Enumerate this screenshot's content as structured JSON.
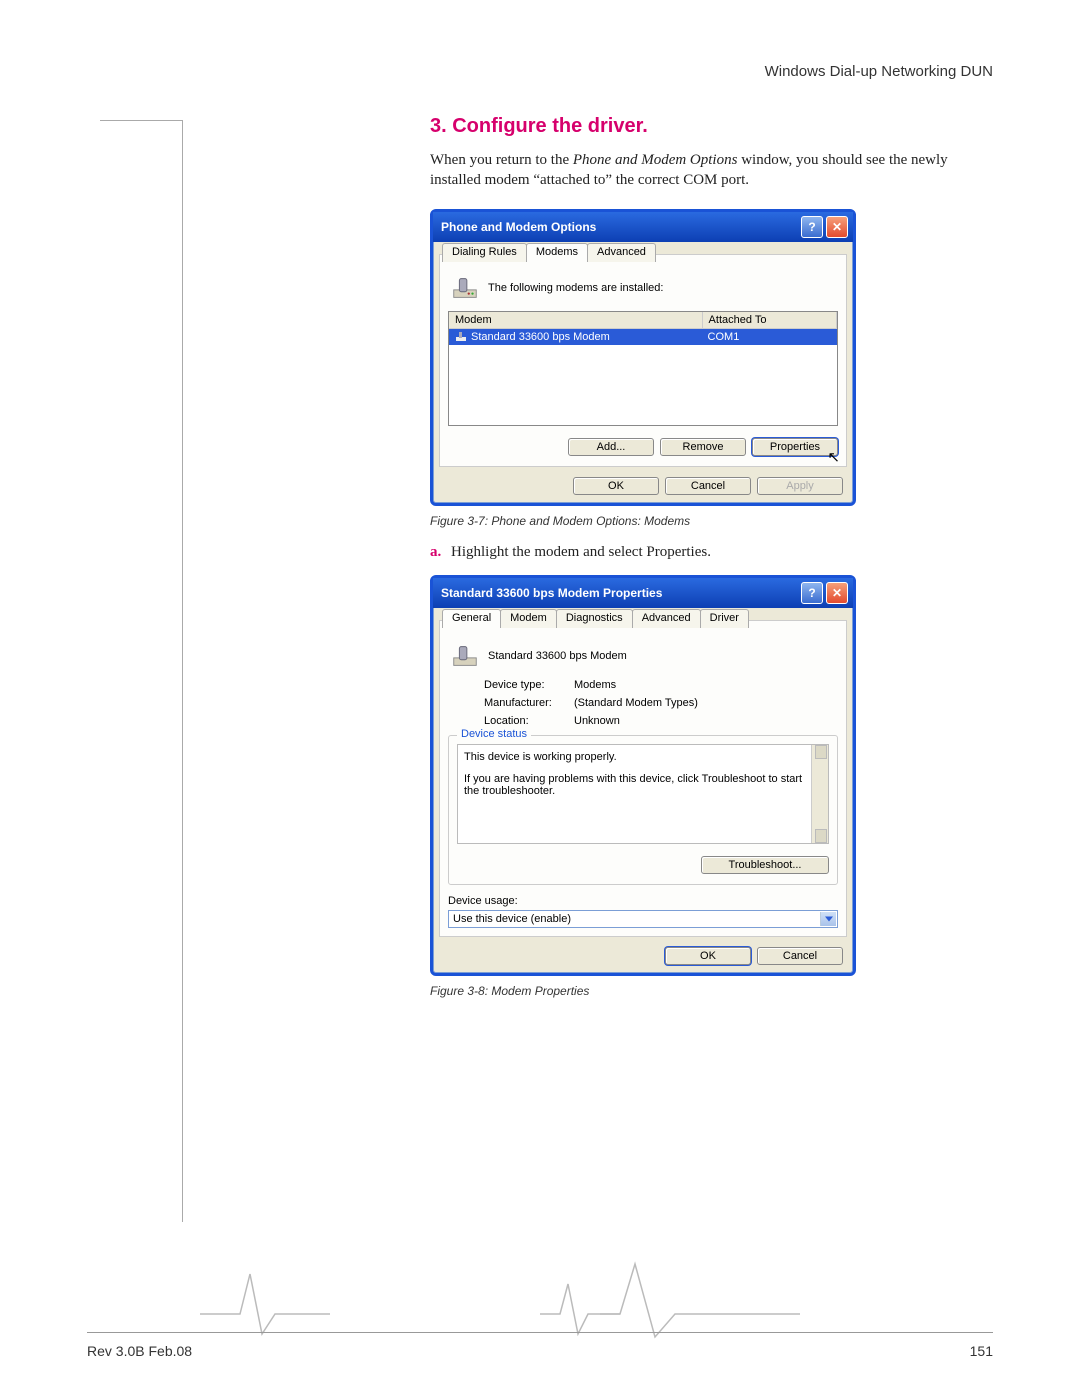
{
  "header": {
    "right": "Windows Dial-up Networking DUN"
  },
  "section": {
    "title": "3. Configure the driver.",
    "intro_pre": "When you return to the ",
    "intro_em": "Phone and Modem Options",
    "intro_post": " window, you should see the newly installed modem “attached to” the correct COM port."
  },
  "dialog1": {
    "title": "Phone and Modem Options",
    "tabs": [
      "Dialing Rules",
      "Modems",
      "Advanced"
    ],
    "active_tab": 1,
    "subtitle": "The following modems are  installed:",
    "columns": [
      "Modem",
      "Attached To"
    ],
    "row": {
      "name": "Standard 33600 bps Modem",
      "port": "COM1"
    },
    "buttons_mid": [
      "Add...",
      "Remove",
      "Properties"
    ],
    "buttons_bottom": [
      "OK",
      "Cancel",
      "Apply"
    ]
  },
  "caption1": "Figure 3-7: Phone and Modem Options: Modems",
  "step_a": {
    "label": "a.",
    "text_pre": "Highlight the modem and select ",
    "text_em": "Properties",
    "text_post": "."
  },
  "dialog2": {
    "title": "Standard 33600 bps Modem Properties",
    "tabs": [
      "General",
      "Modem",
      "Diagnostics",
      "Advanced",
      "Driver"
    ],
    "active_tab": 0,
    "name": "Standard 33600 bps Modem",
    "rows": [
      {
        "k": "Device type:",
        "v": "Modems"
      },
      {
        "k": "Manufacturer:",
        "v": "(Standard Modem Types)"
      },
      {
        "k": "Location:",
        "v": "Unknown"
      }
    ],
    "status_legend": "Device status",
    "status_text1": "This device is working properly.",
    "status_text2": "If you are having problems with this device, click Troubleshoot to start the troubleshooter.",
    "troubleshoot": "Troubleshoot...",
    "usage_label": "Device usage:",
    "usage_value": "Use this device (enable)",
    "buttons_bottom": [
      "OK",
      "Cancel"
    ]
  },
  "caption2": "Figure 3-8: Modem Properties",
  "footer": {
    "left": "Rev 3.0B Feb.08",
    "right": "151"
  }
}
